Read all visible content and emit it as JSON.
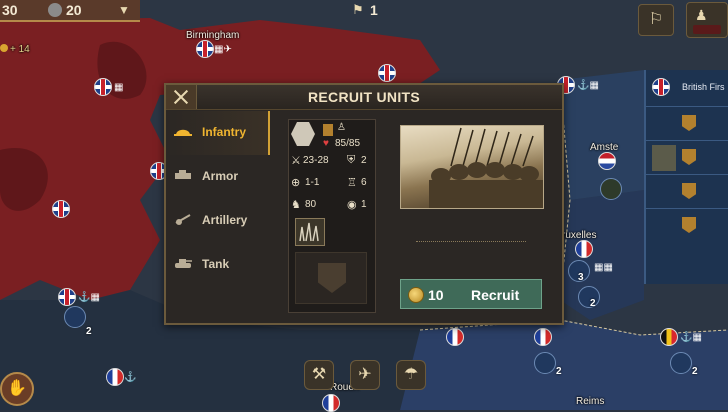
{
  "top_bar": {
    "left_value": "30",
    "second_value": "20",
    "third_value": "1"
  },
  "map_labels": {
    "city_1": "Birmingham",
    "city_2": "Amste",
    "city_3": "ruxelles",
    "city_4": "Rouen",
    "city_5": "Reims",
    "gold_label": "+ 14"
  },
  "side_panel": {
    "title": "British Firs"
  },
  "map_units": {
    "n1": "2",
    "n2": "2",
    "n3": "3",
    "n4": "2",
    "n5": "2",
    "n6": "2"
  },
  "dialog": {
    "title": "RECRUIT UNITS",
    "tabs": [
      {
        "label": "Infantry",
        "icon": "infantry-helmet-icon",
        "active": true
      },
      {
        "label": "Armor",
        "icon": "armor-icon",
        "active": false
      },
      {
        "label": "Artillery",
        "icon": "artillery-icon",
        "active": false
      },
      {
        "label": "Tank",
        "icon": "tank-icon",
        "active": false
      }
    ],
    "stats": {
      "hp": "85/85",
      "attack": "23-28",
      "defense": "2",
      "range": "1-1",
      "movement": "6",
      "organization": "80",
      "vision": "1"
    },
    "recruit": {
      "cost": "10",
      "label": "Recruit"
    }
  },
  "colors": {
    "accent": "#f0b530",
    "recruit_button": "#3f6a58",
    "allied_blue": "#1d3350",
    "axis_red": "#7a1f1f"
  }
}
